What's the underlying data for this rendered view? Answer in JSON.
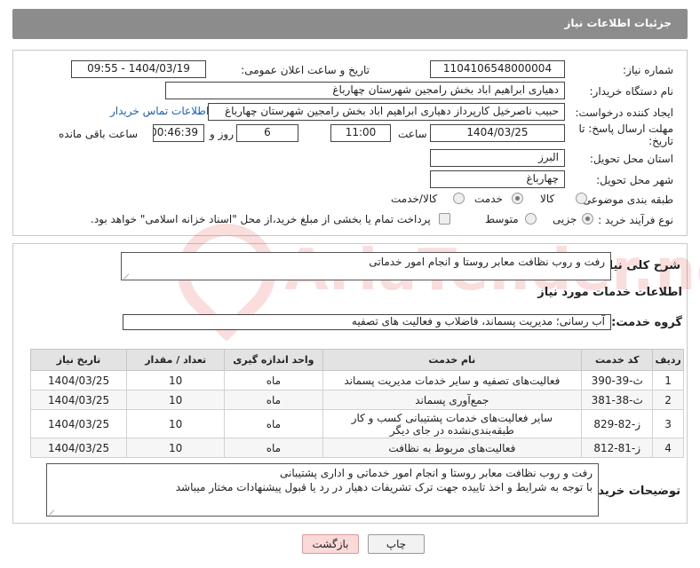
{
  "header": {
    "title": "جزئیات اطلاعات نیاز"
  },
  "form": {
    "need_number": {
      "label": "شماره نیاز:",
      "value": "1104106548000004"
    },
    "announce_datetime": {
      "label": "تاریخ و ساعت اعلان عمومی:",
      "value": "1404/03/19 - 09:55"
    },
    "buyer_org": {
      "label": "نام دستگاه خریدار:",
      "value": "دهیاری ابراهیم اباد بخش رامجین شهرستان چهارباغ"
    },
    "requester": {
      "label": "ایجاد کننده درخواست:",
      "value": "حبیب ناصرخیل کارپرداز دهیاری ابراهیم اباد بخش رامجین شهرستان چهارباغ",
      "contact_link": "اطلاعات تماس خریدار"
    },
    "deadline": {
      "label_line1": "مهلت ارسال پاسخ: تا",
      "label_line2": "تاریخ:",
      "date": "1404/03/25",
      "time_label": "ساعت",
      "time": "11:00",
      "days": "6",
      "days_label": "روز و",
      "remaining": "00:46:39",
      "remaining_label": "ساعت باقی مانده"
    },
    "province": {
      "label": "استان محل تحویل:",
      "value": "البرز"
    },
    "city": {
      "label": "شهر محل تحویل:",
      "value": "چهارباغ"
    },
    "category": {
      "label": "طبقه بندی موضوعی:",
      "options": [
        "کالا",
        "خدمت",
        "کالا/خدمت"
      ],
      "selected": "خدمت"
    },
    "purchase_type": {
      "label": "نوع فرآیند خرید :",
      "options": [
        "جزیی",
        "متوسط"
      ],
      "selected": "جزیی",
      "treasury_note": "پرداخت تمام یا بخشی از مبلغ خرید،از محل \"اسناد خزانه اسلامی\" خواهد بود."
    }
  },
  "description": {
    "label": "شرح کلی نیاز:",
    "value": "رفت و روب نظافت معابر روستا و انجام امور خدماتی"
  },
  "services": {
    "section_title": "اطلاعات خدمات مورد نیاز",
    "group_label": "گروه خدمت:",
    "group_value": "آب رسانی؛ مدیریت پسماند، فاضلاب و فعالیت های تصفیه",
    "columns": [
      "ردیف",
      "کد خدمت",
      "نام خدمت",
      "واحد اندازه گیری",
      "تعداد / مقدار",
      "تاریخ نیاز"
    ],
    "rows": [
      [
        "1",
        "ث-39-390",
        "فعالیت‌های تصفیه و سایر خدمات مدیریت پسماند",
        "ماه",
        "10",
        "1404/03/25"
      ],
      [
        "2",
        "ث-38-381",
        "جمع‌آوری پسماند",
        "ماه",
        "10",
        "1404/03/25"
      ],
      [
        "3",
        "ز-82-829",
        "سایر فعالیت‌های خدمات پشتیبانی کسب و کار طبقه‌بندی‌نشده در جای دیگر",
        "ماه",
        "10",
        "1404/03/25"
      ],
      [
        "4",
        "ز-81-812",
        "فعالیت‌های مربوط به نظافت",
        "ماه",
        "10",
        "1404/03/25"
      ]
    ]
  },
  "buyer_notes": {
    "label": "توضیحات خریدار:",
    "line1": "رفت و روب نظافت معابر روستا و انجام امور خدماتی و اداری پشتیبانی",
    "line2": "با توجه به شرایط و اخذ تاییده جهت ترک تشریفات دهیار در رد یا قبول پیشنهادات مختار میباشد"
  },
  "buttons": {
    "print": "چاپ",
    "back": "بازگشت"
  },
  "watermark": {
    "text": "AriaTender.neT"
  }
}
